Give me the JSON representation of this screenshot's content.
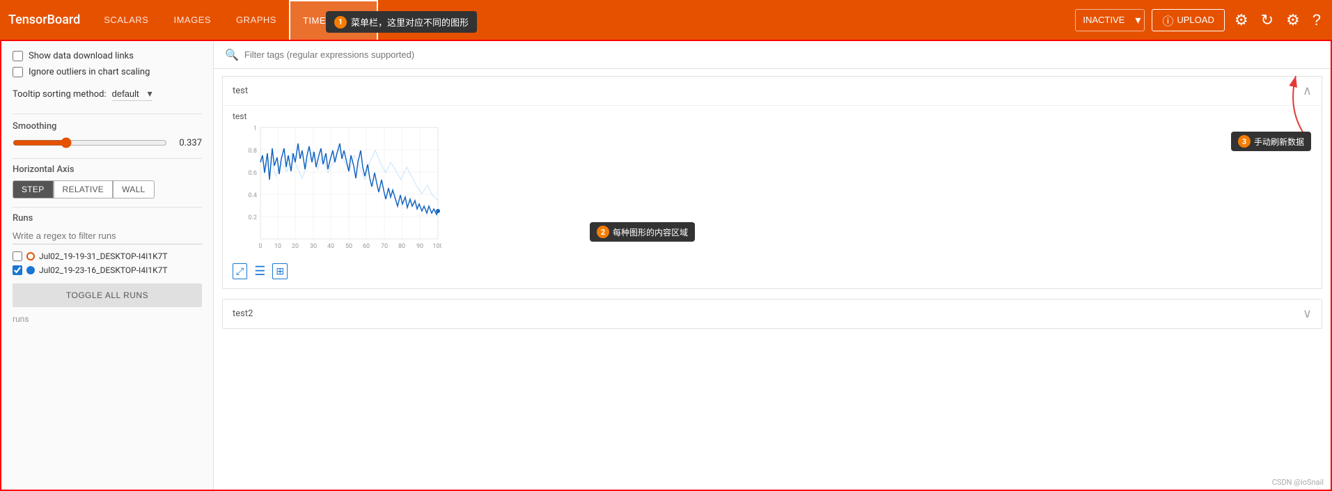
{
  "header": {
    "logo": "TensorBoard",
    "nav": [
      "SCALARS",
      "IMAGES",
      "GRAPHS",
      "TIME SERIES"
    ],
    "active_tab": "TIME SERIES",
    "inactive_label": "INACTIVE",
    "upload_label": "UPLOAD",
    "tooltip1": "菜单栏，这里对应不同的图形"
  },
  "sidebar": {
    "checkbox1": "Show data download links",
    "checkbox2": "Ignore outliers in chart scaling",
    "tooltip_label": "Tooltip sorting method:",
    "tooltip_value": "default",
    "smoothing_label": "Smoothing",
    "smoothing_value": "0.337",
    "horizontal_axis_label": "Horizontal Axis",
    "axis_btns": [
      "STEP",
      "RELATIVE",
      "WALL"
    ],
    "active_axis": "STEP",
    "runs_label": "Runs",
    "runs_filter_placeholder": "Write a regex to filter runs",
    "run1": "Jul02_19-19-31_DESKTOP-I4I1K7T",
    "run2": "Jul02_19-23-16_DESKTOP-I4I1K7T",
    "toggle_all": "TOGGLE ALL RUNS",
    "runs_footer": "runs"
  },
  "content": {
    "filter_placeholder": "Filter tags (regular expressions supported)",
    "section1_title": "test",
    "chart1_name": "test",
    "section2_title": "test2",
    "tooltip2": "每种图形的内容区域",
    "tooltip3": "手动刷新数据"
  },
  "annotations": {
    "num1": "1",
    "num2": "2",
    "num3": "3"
  }
}
